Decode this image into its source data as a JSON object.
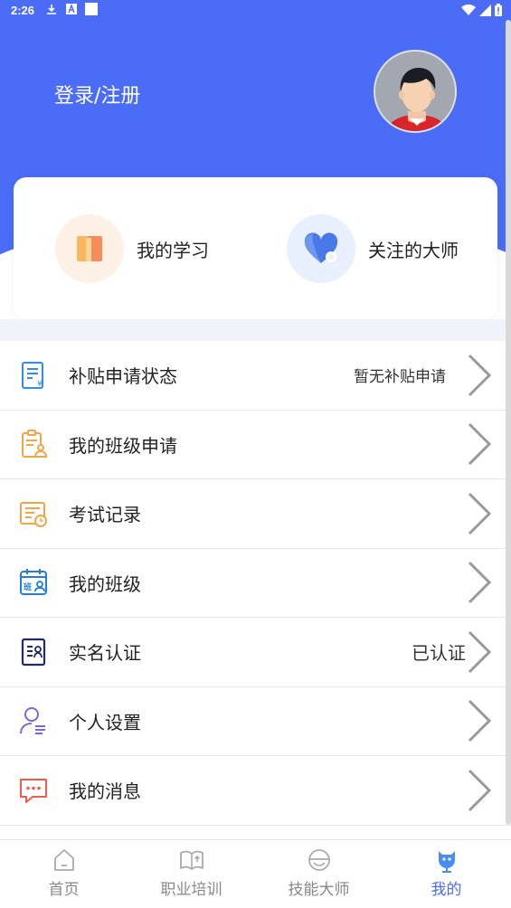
{
  "status_bar": {
    "time": "2:26"
  },
  "header": {
    "login_label": "登录/注册"
  },
  "quick_actions": [
    {
      "label": "我的学习",
      "icon": "book-icon"
    },
    {
      "label": "关注的大师",
      "icon": "heart-icon"
    }
  ],
  "menu": [
    {
      "label": "补贴申请状态",
      "value": "暂无补贴申请",
      "icon": "subsidy-doc-icon"
    },
    {
      "label": "我的班级申请",
      "value": "",
      "icon": "class-apply-icon"
    },
    {
      "label": "考试记录",
      "value": "",
      "icon": "exam-record-icon"
    },
    {
      "label": "我的班级",
      "value": "",
      "icon": "class-calendar-icon"
    },
    {
      "label": "实名认证",
      "value": "已认证",
      "icon": "id-card-icon"
    },
    {
      "label": "个人设置",
      "value": "",
      "icon": "user-settings-icon"
    },
    {
      "label": "我的消息",
      "value": "",
      "icon": "message-icon"
    }
  ],
  "tabs": [
    {
      "label": "首页",
      "icon": "home-icon",
      "active": false
    },
    {
      "label": "职业培训",
      "icon": "training-book-icon",
      "active": false
    },
    {
      "label": "技能大师",
      "icon": "master-icon",
      "active": false
    },
    {
      "label": "我的",
      "icon": "profile-icon",
      "active": true
    }
  ],
  "colors": {
    "primary": "#4a6cf6",
    "orange": "#f5a445",
    "blue_icon": "#2f8fe6",
    "red_icon": "#ef5a4a",
    "purple_icon": "#7b68d8"
  }
}
